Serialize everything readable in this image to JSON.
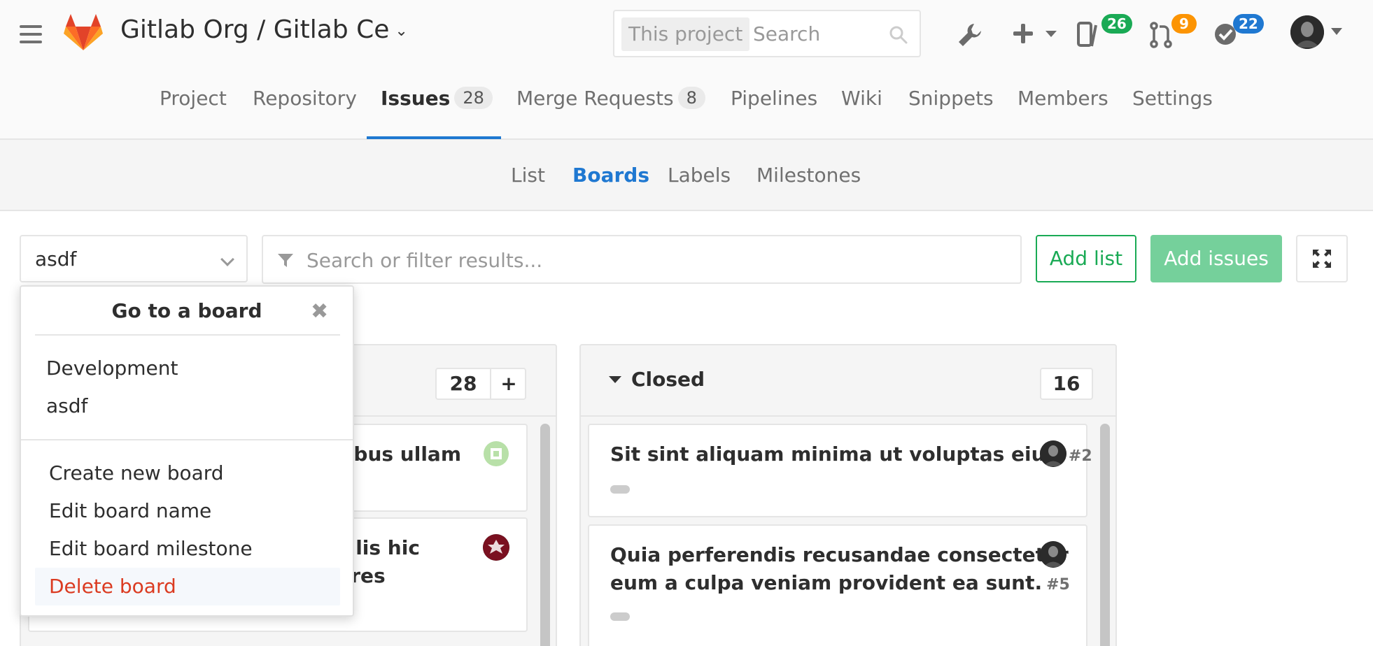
{
  "header": {
    "project_title": "Gitlab Org / Gitlab Ce",
    "search_scope": "This project",
    "search_placeholder": "Search",
    "todos_count": "26",
    "merge_requests_count": "9",
    "issues_count": "22"
  },
  "nav": {
    "items": [
      {
        "label": "Project"
      },
      {
        "label": "Repository"
      },
      {
        "label": "Issues",
        "badge": "28"
      },
      {
        "label": "Merge Requests",
        "badge": "8"
      },
      {
        "label": "Pipelines"
      },
      {
        "label": "Wiki"
      },
      {
        "label": "Snippets"
      },
      {
        "label": "Members"
      },
      {
        "label": "Settings"
      }
    ],
    "active": "Issues"
  },
  "subnav": {
    "items": [
      {
        "label": "List"
      },
      {
        "label": "Boards"
      },
      {
        "label": "Labels"
      },
      {
        "label": "Milestones"
      }
    ],
    "active": "Boards"
  },
  "toolbar": {
    "board_selected": "asdf",
    "filter_placeholder": "Search or filter results...",
    "add_list_label": "Add list",
    "add_issues_label": "Add issues"
  },
  "dropdown": {
    "title": "Go to a board",
    "close_glyph": "✖",
    "boards": [
      "Development",
      "asdf"
    ],
    "actions": [
      "Create new board",
      "Edit board name",
      "Edit board milestone"
    ],
    "danger_action": "Delete board"
  },
  "lists": {
    "first": {
      "count": "28",
      "add_glyph": "+",
      "cards": [
        {
          "title_fragment": "ribus ullam"
        },
        {
          "title_line1": "cilis hic",
          "title_line2": "ores"
        }
      ]
    },
    "closed": {
      "title": "Closed",
      "count": "16",
      "cards": [
        {
          "title": "Sit sint aliquam minima ut voluptas eius.",
          "iid": "#2"
        },
        {
          "title_line1": "Quia perferendis recusandae consectetur",
          "title_line2": "eum a culpa veniam provident ea sunt.",
          "iid": "#5"
        }
      ]
    }
  },
  "colors": {
    "accent_blue": "#1f78d1",
    "green": "#1aaa55",
    "green_light": "#75d09b",
    "orange": "#fc9403",
    "danger": "#db3b21"
  }
}
